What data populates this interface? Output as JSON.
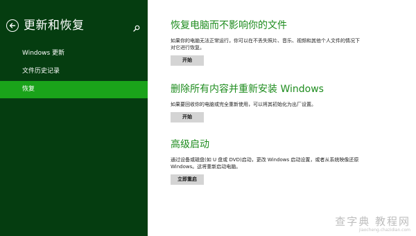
{
  "sidebar": {
    "title": "更新和恢复",
    "items": [
      {
        "label": "Windows 更新"
      },
      {
        "label": "文件历史记录"
      },
      {
        "label": "恢复",
        "selected": true
      }
    ]
  },
  "icons": {
    "back": "back-arrow-icon",
    "search": "search-icon"
  },
  "sections": [
    {
      "title": "恢复电脑而不影响你的文件",
      "description": "如果你的电脑无法正常运行，你可以在不丢失照片、音乐、视频和其他个人文件的情况下对它进行恢复。",
      "button": "开始"
    },
    {
      "title": "删除所有内容并重新安装 Windows",
      "description": "如果要回收你的电脑或完全重新使用，可以将其初始化为出厂设置。",
      "button": "开始"
    },
    {
      "title": "高级启动",
      "description": "通过设备或磁盘(如 U 盘或 DVD)启动，更改 Windows 启动设置，或者从系统映像还原 Windows。这将重新启动电脑。",
      "button": "立即重启"
    }
  ],
  "watermark": {
    "main": "查字典 教程网",
    "sub": "jiaocheng.chazidian.com"
  },
  "colors": {
    "sidebar_bg": "#053d10",
    "selected_bg": "#1aa31a",
    "title_green": "#1e8c1e",
    "button_bg": "#d4d4d4"
  }
}
